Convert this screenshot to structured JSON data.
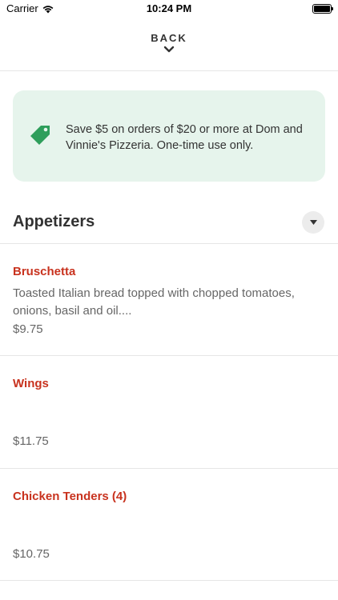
{
  "status_bar": {
    "carrier": "Carrier",
    "time": "10:24 PM"
  },
  "nav": {
    "back_label": "BACK"
  },
  "promo": {
    "icon": "price-tag-icon",
    "color": "#2e9e5b",
    "background": "#e6f4ec",
    "text": "Save $5 on orders of $20 or more at Dom and Vinnie's Pizzeria. One-time use only."
  },
  "menu": {
    "section_title": "Appetizers",
    "accent_color": "#c8321e",
    "items": [
      {
        "name": "Bruschetta",
        "description": "Toasted Italian bread topped with chopped tomatoes, onions, basil and oil....",
        "price": "$9.75"
      },
      {
        "name": "Wings",
        "description": "",
        "price": "$11.75"
      },
      {
        "name": "Chicken Tenders (4)",
        "description": "",
        "price": "$10.75"
      }
    ]
  }
}
